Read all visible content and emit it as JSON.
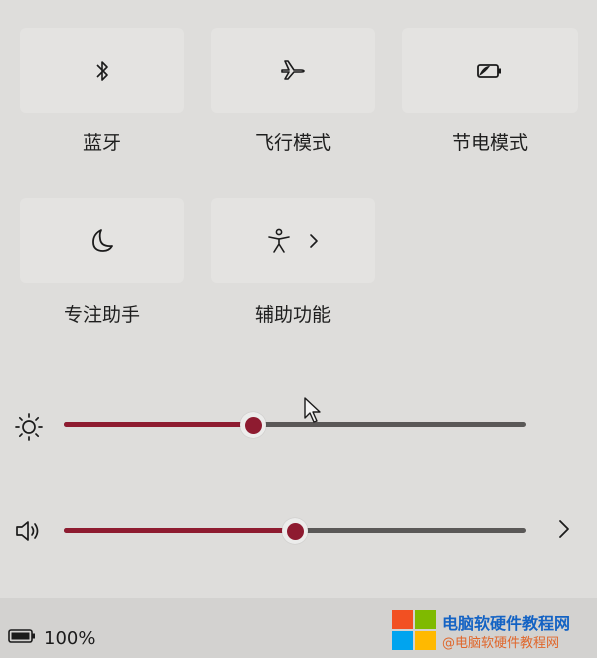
{
  "quick_settings": {
    "tiles": [
      {
        "label": "蓝牙",
        "icon": "bluetooth-icon"
      },
      {
        "label": "飞行模式",
        "icon": "airplane-icon"
      },
      {
        "label": "节电模式",
        "icon": "battery-saver-icon"
      },
      {
        "label": "专注助手",
        "icon": "moon-icon"
      },
      {
        "label": "辅助功能",
        "icon": "accessibility-icon"
      }
    ]
  },
  "sliders": {
    "brightness": {
      "icon": "sun-icon",
      "level": 0.41
    },
    "volume": {
      "icon": "speaker-icon",
      "level": 0.5
    }
  },
  "footer": {
    "battery_label": "100%",
    "battery_icon": "battery-icon"
  },
  "watermark": {
    "title": "电脑软硬件教程网",
    "subtitle": "@电脑软硬件教程网"
  },
  "colors": {
    "accent": "#8e1b30",
    "track": "#5a5857",
    "tile": "#e4e3e1"
  }
}
